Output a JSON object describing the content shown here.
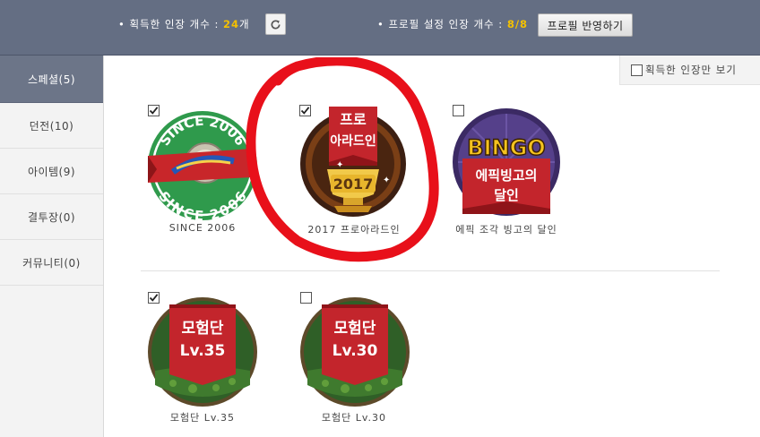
{
  "header": {
    "acquired_prefix": "• 획득한 인장 개수 : ",
    "acquired_count": "24",
    "acquired_suffix": "개",
    "profile_prefix": "• 프로필 설정 인장 개수 : ",
    "profile_count": "8/8",
    "apply_label": "프로필 반영하기",
    "refresh_icon": "refresh-icon"
  },
  "sidebar": {
    "items": [
      {
        "label": "스페셜(5)",
        "active": true
      },
      {
        "label": "던전(10)",
        "active": false
      },
      {
        "label": "아이템(9)",
        "active": false
      },
      {
        "label": "결투장(0)",
        "active": false
      },
      {
        "label": "커뮤니티(0)",
        "active": false
      }
    ]
  },
  "filter": {
    "label": "획득한 인장만 보기",
    "checked": false
  },
  "badges": [
    {
      "label": "SINCE 2006",
      "checked": true,
      "art": {
        "top": "SINCE 2006",
        "bottom": "SINCE 2006"
      }
    },
    {
      "label": "2017 프로아라드인",
      "checked": true,
      "art": {
        "line1": "프로",
        "line2": "아라드인",
        "year": "2017"
      }
    },
    {
      "label": "에픽 조각 빙고의 달인",
      "checked": false,
      "art": {
        "title": "BINGO",
        "line1": "에픽빙고의",
        "line2": "달인"
      }
    },
    {
      "label": "모험단 Lv.35",
      "checked": true,
      "art": {
        "line1": "모험단",
        "line2": "Lv.35"
      }
    },
    {
      "label": "모험단 Lv.30",
      "checked": false,
      "art": {
        "line1": "모험단",
        "line2": "Lv.30"
      }
    }
  ],
  "colors": {
    "topbar": "#646e83",
    "accent_count": "#f4c100",
    "sidebar_active": "#6c7588",
    "annotation_red": "#e8101a"
  }
}
